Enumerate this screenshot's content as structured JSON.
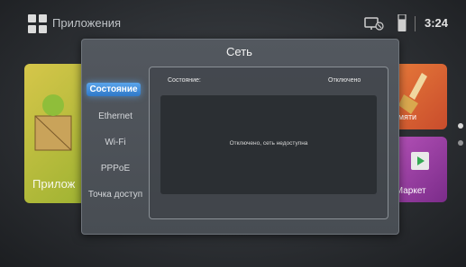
{
  "header": {
    "title": "Приложения",
    "time": "3:24"
  },
  "tiles": {
    "left_label": "Прилож",
    "right1_label": "памяти",
    "right2_label": "у Маркет"
  },
  "dialog": {
    "title": "Сеть",
    "menu": [
      "Состояние",
      "Ethernet",
      "Wi-Fi",
      "PPPoE",
      "Точка доступ"
    ],
    "status_label": "Состояние:",
    "status_value": "Отключено",
    "message": "Отключено, сеть недоступна"
  },
  "colors": {
    "accent": "#3d8ee0",
    "tile_green": "#bfbd3e",
    "tile_orange": "#e06f35",
    "tile_purple": "#9c44a3"
  }
}
